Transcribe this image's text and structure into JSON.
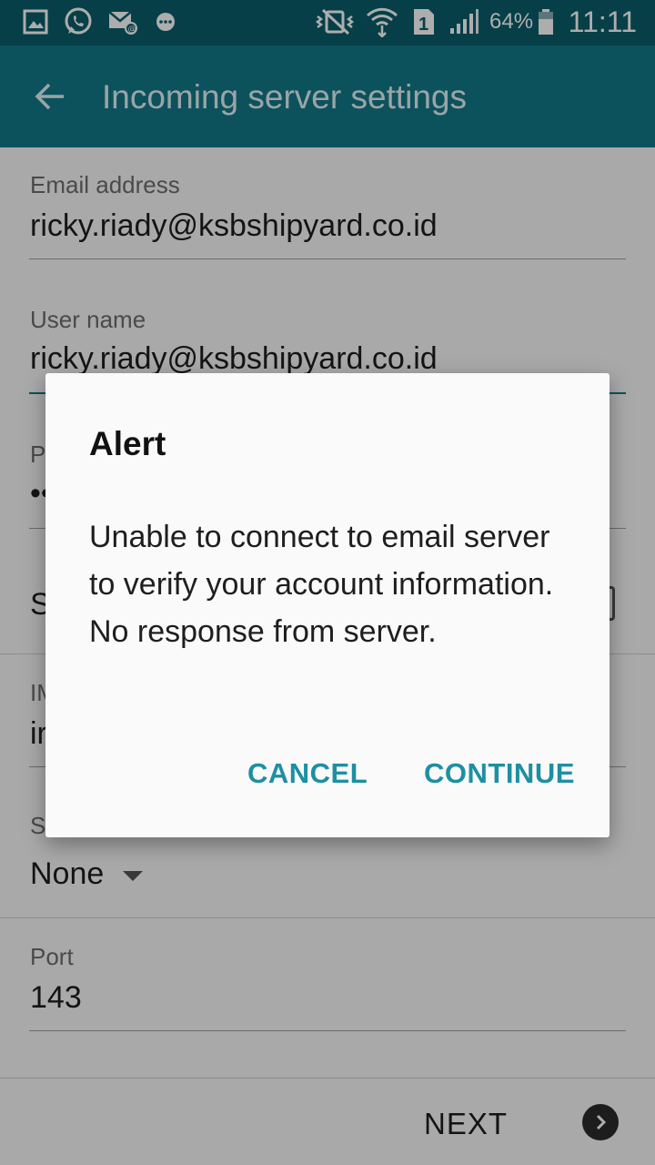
{
  "status_bar": {
    "battery_percent": "64%",
    "time": "11:11",
    "sim_slot": "1",
    "icons": [
      "gallery-icon",
      "whatsapp-icon",
      "email-icon",
      "chat-icon",
      "mute-vibrate-icon",
      "wifi-icon",
      "sim-icon",
      "signal-icon",
      "battery-icon"
    ]
  },
  "app_bar": {
    "title": "Incoming server settings",
    "back_icon": "arrow-left-icon"
  },
  "form": {
    "email": {
      "label": "Email address",
      "value": "ricky.riady@ksbshipyard.co.id"
    },
    "username": {
      "label": "User name",
      "value": "ricky.riady@ksbshipyard.co.id"
    },
    "password": {
      "label_partial": "P",
      "value_partial": "••"
    },
    "show_password": {
      "label_partial": "S"
    },
    "imap_server": {
      "label_partial": "IM",
      "value_partial": "ir"
    },
    "security": {
      "label_partial": "S",
      "value": "None"
    },
    "port": {
      "label": "Port",
      "value": "143"
    }
  },
  "footer": {
    "next_label": "NEXT"
  },
  "dialog": {
    "title": "Alert",
    "message": "Unable to connect to email server to verify your account information. No response from server.",
    "cancel_label": "CANCEL",
    "continue_label": "CONTINUE"
  },
  "colors": {
    "status_bar": "#0a5e6b",
    "app_bar": "#127a8a",
    "accent": "#1e8fa3"
  }
}
